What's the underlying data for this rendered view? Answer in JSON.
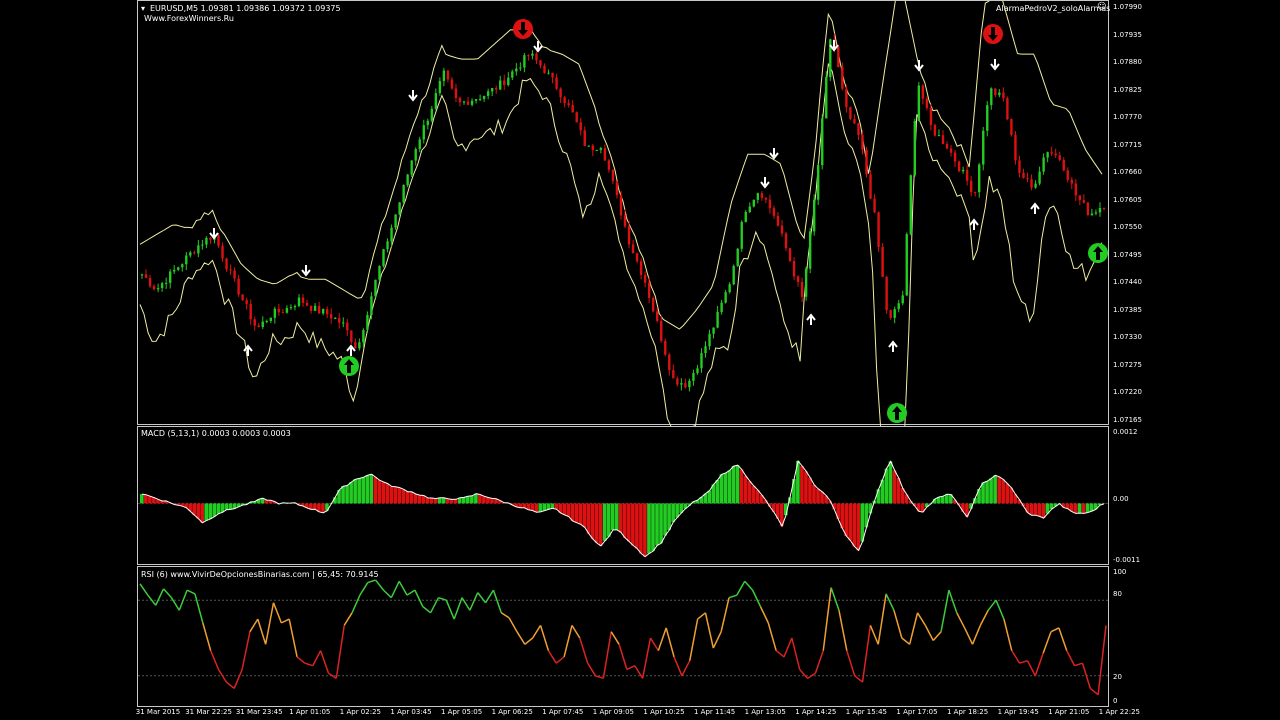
{
  "header": {
    "symbol_line": "EURUSD,M5  1.09381 1.09386 1.09372 1.09375",
    "site": "Www.ForexWinners.Ru",
    "indicator_name": "AlarmaPedroV2_soloAlarmas"
  },
  "macd": {
    "label": "MACD (5,13,1) 0.0003 0.0003 0.0003",
    "levels": [
      "0.0012",
      "0.00",
      "-0.0011"
    ]
  },
  "rsi": {
    "label": "RSI (6) www.VivirDeOpcionesBinarias.com | 65,45: 70.9145",
    "levels": [
      "100",
      "80",
      "20",
      "0"
    ]
  },
  "colors": {
    "bull": "#22cc22",
    "bear": "#dd1111",
    "band": "#f0eea0",
    "rsi_hi": "#3ccc3c",
    "rsi_mid": "#f0a030",
    "rsi_lo": "#dd2222",
    "arrow_green": "#22cc22",
    "arrow_red": "#dd1111"
  },
  "chart_data": [
    {
      "type": "candlestick",
      "title": "EURUSD,M5",
      "ylim": [
        1.07165,
        1.0799
      ],
      "yticks": [
        "1.07990",
        "1.07935",
        "1.07880",
        "1.07825",
        "1.07770",
        "1.07715",
        "1.07660",
        "1.07605",
        "1.07550",
        "1.07495",
        "1.07440",
        "1.07385",
        "1.07330",
        "1.07275",
        "1.07220",
        "1.07165"
      ],
      "x": [
        "31 Mar 2015",
        "31 Mar 22:25",
        "31 Mar 23:45",
        "1 Apr 01:05",
        "1 Apr 02:25",
        "1 Apr 03:45",
        "1 Apr 05:05",
        "1 Apr 06:25",
        "1 Apr 07:45",
        "1 Apr 09:05",
        "1 Apr 10:25",
        "1 Apr 11:45",
        "1 Apr 13:05",
        "1 Apr 14:25",
        "1 Apr 15:45",
        "1 Apr 17:05",
        "1 Apr 18:25",
        "1 Apr 19:45",
        "1 Apr 21:05",
        "1 Apr 22:25"
      ],
      "close_path": [
        1.0746,
        1.0743,
        1.0746,
        1.0749,
        1.0752,
        1.0754,
        1.0747,
        1.0741,
        1.0735,
        1.0738,
        1.0739,
        1.0741,
        1.0739,
        1.0738,
        1.0736,
        1.0731,
        1.0742,
        1.0752,
        1.0761,
        1.0771,
        1.0778,
        1.0786,
        1.078,
        1.0781,
        1.0782,
        1.0784,
        1.0787,
        1.079,
        1.0787,
        1.0783,
        1.0778,
        1.0771,
        1.0772,
        1.0762,
        1.0752,
        1.0745,
        1.0735,
        1.0725,
        1.0724,
        1.073,
        1.0737,
        1.0745,
        1.0759,
        1.0763,
        1.0758,
        1.075,
        1.0741,
        1.0765,
        1.0795,
        1.0779,
        1.0773,
        1.0758,
        1.0736,
        1.0742,
        1.0785,
        1.0775,
        1.0772,
        1.0767,
        1.0762,
        1.0783,
        1.0781,
        1.0767,
        1.0763,
        1.0771,
        1.0769,
        1.0762,
        1.0758,
        1.076
      ],
      "bands": {
        "upper_path": [
          1.0752,
          1.0754,
          1.0756,
          1.0755,
          1.0758,
          1.0754,
          1.0748,
          1.0745,
          1.0744,
          1.0746,
          1.0745,
          1.0745,
          1.0743,
          1.0741,
          1.0744,
          1.0752,
          1.0765,
          1.0781,
          1.079,
          1.0789,
          1.0789,
          1.0792,
          1.0795,
          1.0794,
          1.0791,
          1.079,
          1.0788,
          1.0779,
          1.0763,
          1.075,
          1.0742,
          1.0737,
          1.0735,
          1.0739,
          1.0744,
          1.076,
          1.077,
          1.077,
          1.0768,
          1.0755,
          1.075,
          1.0749,
          1.0752,
          1.0761,
          1.0784,
          1.0806,
          1.079,
          1.0772,
          1.0765,
          1.0762,
          1.08,
          1.0802,
          1.079,
          1.079,
          1.078,
          1.0779,
          1.0771,
          1.0766
        ]
      }
    },
    {
      "type": "bar",
      "title": "MACD (5,13,1)",
      "ylim": [
        -0.0011,
        0.0012
      ],
      "values": [
        0.0002,
        0.0001,
        0.0,
        -0.0001,
        -0.0004,
        -0.0002,
        -0.0001,
        0.0,
        0.0001,
        0.0,
        0.0,
        -0.0001,
        -0.0002,
        0.0003,
        0.0005,
        0.0006,
        0.0004,
        0.0003,
        0.0002,
        0.0001,
        0.0001,
        0.0001,
        0.0002,
        0.0001,
        0.0,
        -0.0001,
        -0.0002,
        -0.0001,
        -0.0003,
        -0.0005,
        -0.0009,
        -0.0005,
        -0.0008,
        -0.0011,
        -0.0008,
        -0.0003,
        0.0,
        0.0002,
        0.0006,
        0.0008,
        0.0004,
        0.0,
        -0.0005,
        0.0009,
        0.0004,
        0.0001,
        -0.0006,
        -0.001,
        0.0001,
        0.0009,
        0.0002,
        -0.0002,
        0.0001,
        0.0002,
        -0.0003,
        0.0004,
        0.0006,
        0.0003,
        -0.0002,
        -0.0003,
        0.0,
        -0.0002,
        -0.0002,
        0.0
      ]
    },
    {
      "type": "line",
      "title": "RSI (6)",
      "ylim": [
        0,
        100
      ],
      "levels": [
        80,
        20
      ],
      "values": [
        93,
        84,
        76,
        89,
        82,
        72,
        88,
        85,
        62,
        40,
        25,
        15,
        10,
        25,
        55,
        65,
        45,
        78,
        62,
        65,
        35,
        30,
        28,
        40,
        22,
        18,
        60,
        70,
        84,
        94,
        96,
        88,
        82,
        95,
        84,
        88,
        75,
        70,
        82,
        80,
        65,
        82,
        72,
        86,
        78,
        88,
        70,
        66,
        55,
        45,
        50,
        60,
        40,
        30,
        35,
        60,
        50,
        30,
        20,
        18,
        55,
        45,
        25,
        28,
        18,
        50,
        40,
        58,
        35,
        20,
        32,
        65,
        70,
        42,
        55,
        82,
        84,
        95,
        88,
        75,
        62,
        40,
        35,
        50,
        25,
        18,
        22,
        40,
        90,
        72,
        40,
        20,
        15,
        60,
        45,
        85,
        72,
        50,
        45,
        70,
        60,
        48,
        55,
        88,
        70,
        58,
        45,
        60,
        72,
        80,
        65,
        40,
        30,
        32,
        20,
        38,
        55,
        58,
        40,
        28,
        30,
        10,
        5,
        60
      ]
    }
  ]
}
